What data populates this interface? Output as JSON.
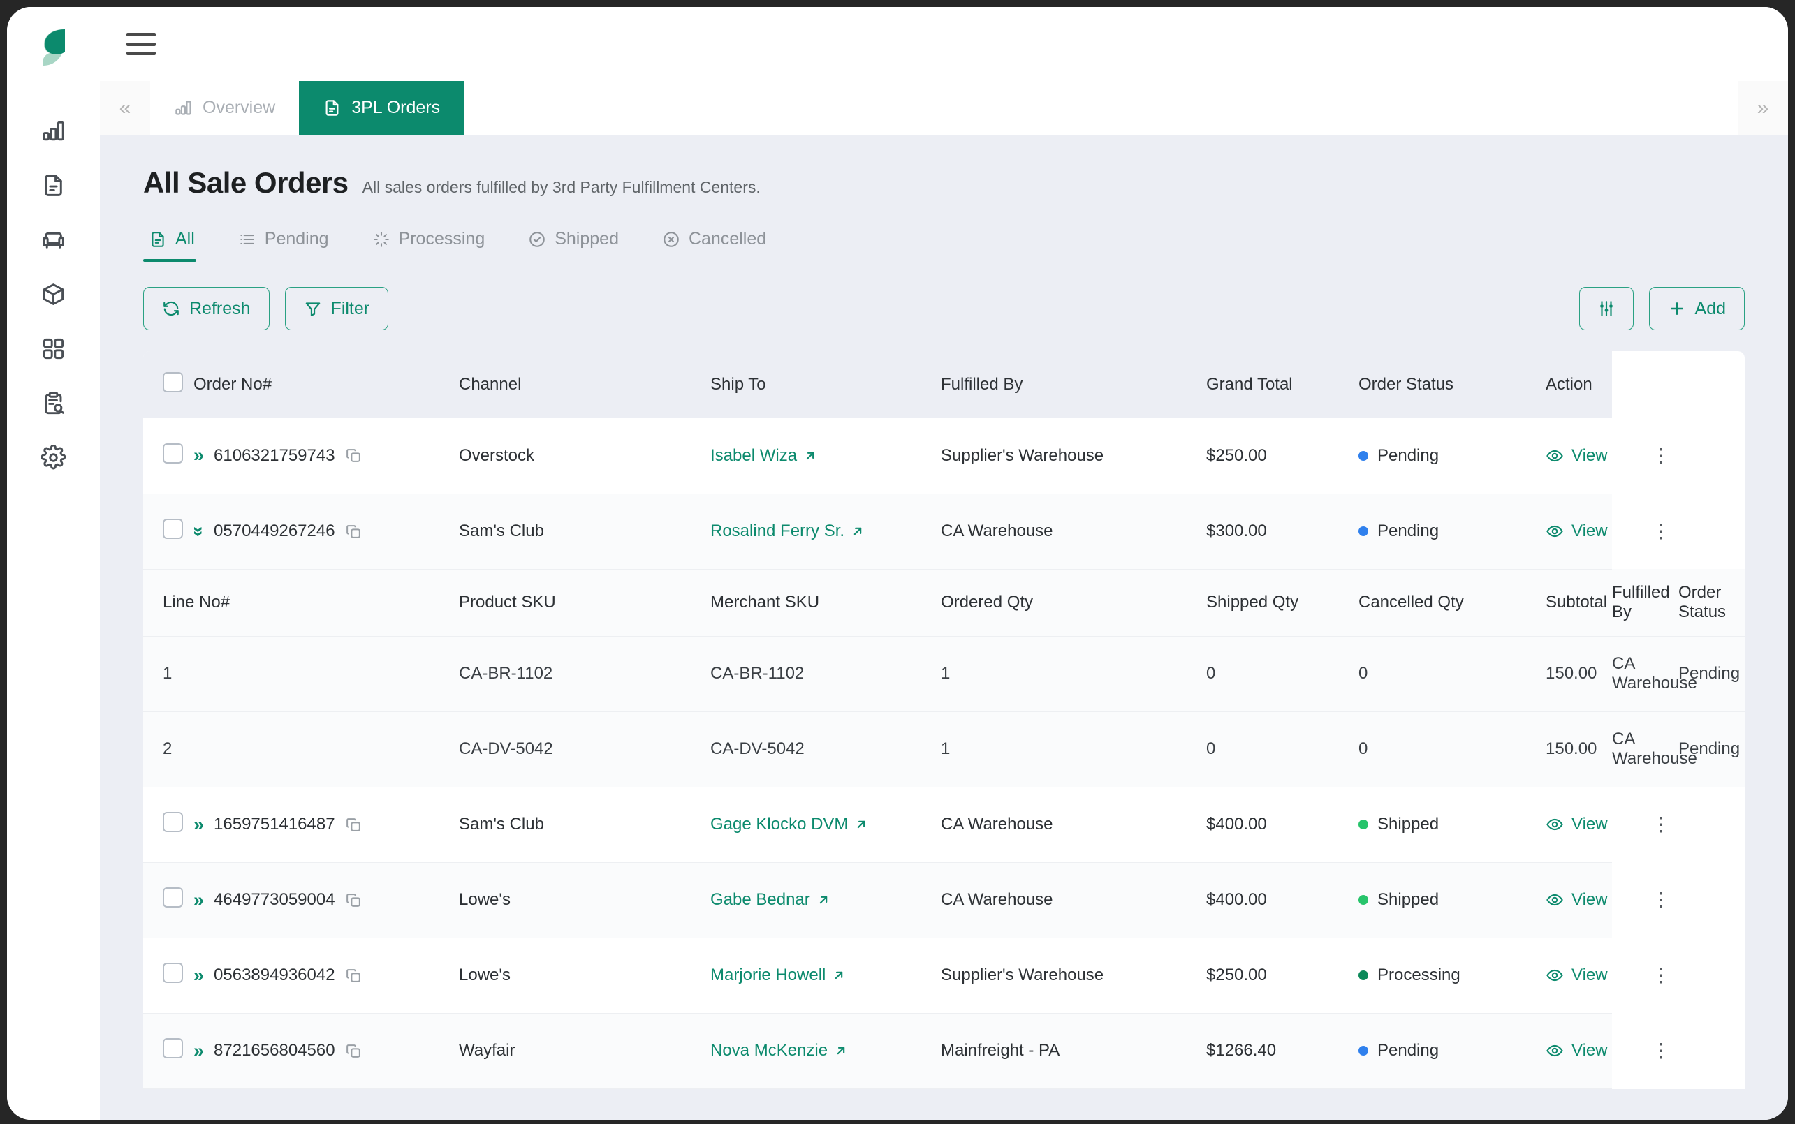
{
  "app": {
    "logo_name": "leaf-logo",
    "rail_items": [
      {
        "name": "analytics",
        "icon": "bar-chart-icon"
      },
      {
        "name": "documents",
        "icon": "document-icon"
      },
      {
        "name": "furniture",
        "icon": "sofa-icon"
      },
      {
        "name": "inventory",
        "icon": "package-icon"
      },
      {
        "name": "apps",
        "icon": "grid-icon"
      },
      {
        "name": "audit",
        "icon": "clipboard-search-icon"
      },
      {
        "name": "settings",
        "icon": "gear-icon"
      }
    ]
  },
  "topbar": {
    "menu_icon": "hamburger-icon"
  },
  "tabstrip": {
    "scroll_left": "«",
    "scroll_right": "»",
    "tabs": [
      {
        "label": "Overview",
        "icon": "bar-chart-icon",
        "active": false
      },
      {
        "label": "3PL Orders",
        "icon": "document-icon",
        "active": true
      }
    ]
  },
  "header": {
    "title": "All Sale Orders",
    "subtitle": "All sales orders fulfilled by 3rd Party Fulfillment Centers."
  },
  "status_tabs": [
    {
      "label": "All",
      "icon": "document-icon",
      "active": true
    },
    {
      "label": "Pending",
      "icon": "list-icon",
      "active": false
    },
    {
      "label": "Processing",
      "icon": "spinner-icon",
      "active": false
    },
    {
      "label": "Shipped",
      "icon": "check-circle-icon",
      "active": false
    },
    {
      "label": "Cancelled",
      "icon": "x-circle-icon",
      "active": false
    }
  ],
  "toolbar": {
    "refresh_label": "Refresh",
    "filter_label": "Filter",
    "settings_label": "",
    "add_label": "Add"
  },
  "table": {
    "headers": {
      "order_no": "Order No#",
      "channel": "Channel",
      "ship_to": "Ship To",
      "fulfilled_by": "Fulfilled By",
      "grand_total": "Grand Total",
      "order_status": "Order Status",
      "action": "Action"
    },
    "view_label": "View",
    "rows": [
      {
        "order_no": "6106321759743",
        "channel": "Overstock",
        "ship_to": "Isabel Wiza",
        "fulfilled_by": "Supplier's Warehouse",
        "grand_total": "$250.00",
        "order_status": "Pending",
        "status_color": "#2f80ed",
        "expanded": false
      },
      {
        "order_no": "0570449267246",
        "channel": "Sam's Club",
        "ship_to": "Rosalind Ferry Sr.",
        "fulfilled_by": "CA Warehouse",
        "grand_total": "$300.00",
        "order_status": "Pending",
        "status_color": "#2f80ed",
        "expanded": true
      },
      {
        "order_no": "1659751416487",
        "channel": "Sam's Club",
        "ship_to": "Gage Klocko DVM",
        "fulfilled_by": "CA Warehouse",
        "grand_total": "$400.00",
        "order_status": "Shipped",
        "status_color": "#27c46b",
        "expanded": false
      },
      {
        "order_no": "4649773059004",
        "channel": "Lowe's",
        "ship_to": "Gabe Bednar",
        "fulfilled_by": "CA Warehouse",
        "grand_total": "$400.00",
        "order_status": "Shipped",
        "status_color": "#27c46b",
        "expanded": false
      },
      {
        "order_no": "0563894936042",
        "channel": "Lowe's",
        "ship_to": "Marjorie Howell",
        "fulfilled_by": "Supplier's Warehouse",
        "grand_total": "$250.00",
        "order_status": "Processing",
        "status_color": "#0c8a5a",
        "expanded": false
      },
      {
        "order_no": "8721656804560",
        "channel": "Wayfair",
        "ship_to": "Nova McKenzie",
        "fulfilled_by": "Mainfreight - PA",
        "grand_total": "$1266.40",
        "order_status": "Pending",
        "status_color": "#2f80ed",
        "expanded": false
      }
    ],
    "sub_table": {
      "headers": {
        "line_no": "Line No#",
        "product_sku": "Product SKU",
        "merchant_sku": "Merchant SKU",
        "ordered_qty": "Ordered Qty",
        "shipped_qty": "Shipped Qty",
        "cancelled_qty": "Cancelled Qty",
        "subtotal": "Subtotal",
        "fulfilled_by": "Fulfilled By",
        "order_status": "Order Status"
      },
      "rows": [
        {
          "line_no": "1",
          "product_sku": "CA-BR-1102",
          "merchant_sku": "CA-BR-1102",
          "ordered_qty": "1",
          "shipped_qty": "0",
          "cancelled_qty": "0",
          "subtotal": "150.00",
          "fulfilled_by": "CA Warehouse",
          "order_status": "Pending"
        },
        {
          "line_no": "2",
          "product_sku": "CA-DV-5042",
          "merchant_sku": "CA-DV-5042",
          "ordered_qty": "1",
          "shipped_qty": "0",
          "cancelled_qty": "0",
          "subtotal": "150.00",
          "fulfilled_by": "CA Warehouse",
          "order_status": "Pending"
        }
      ]
    }
  },
  "colors": {
    "brand_green": "#0c8a6d",
    "page_bg": "#eceef4",
    "pending": "#2f80ed",
    "shipped": "#27c46b",
    "processing": "#0c8a5a"
  }
}
